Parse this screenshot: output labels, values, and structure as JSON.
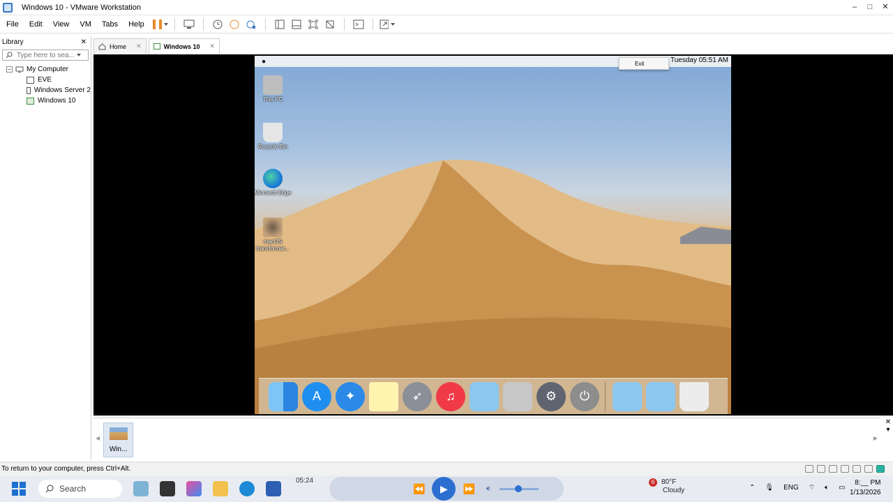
{
  "window": {
    "title": "Windows 10 - VMware Workstation",
    "min": "–",
    "max": "□",
    "close": "✕"
  },
  "menu": {
    "items": [
      "File",
      "Edit",
      "View",
      "VM",
      "Tabs",
      "Help"
    ]
  },
  "library": {
    "title": "Library",
    "close": "✕",
    "search_placeholder": "Type here to sea...",
    "tree": {
      "root": "My Computer",
      "vms": [
        "EVE",
        "Windows Server 2",
        "Windows 10"
      ]
    }
  },
  "tabs": [
    {
      "label": "Home"
    },
    {
      "label": "Windows 10"
    }
  ],
  "guest": {
    "clock": "Tuesday 05:51 AM",
    "exit_label": "Exit",
    "desktop_icons": [
      "This PC",
      "Recycle Bin",
      "Microsoft Edge",
      "macOS transformat..."
    ],
    "colors": {
      "sky": "#7fa6d4",
      "sand": "#d9a865"
    }
  },
  "thumbnail": {
    "label": "Win..."
  },
  "status": {
    "text": "To return to your computer, press Ctrl+Alt."
  },
  "taskbar": {
    "search_label": "Search",
    "media_time": "05:24",
    "weather_badge": "6",
    "temperature": "80°F",
    "condition": "Cloudy",
    "language": "ENG",
    "time": "8:__ PM",
    "date": "1/13/2026"
  }
}
